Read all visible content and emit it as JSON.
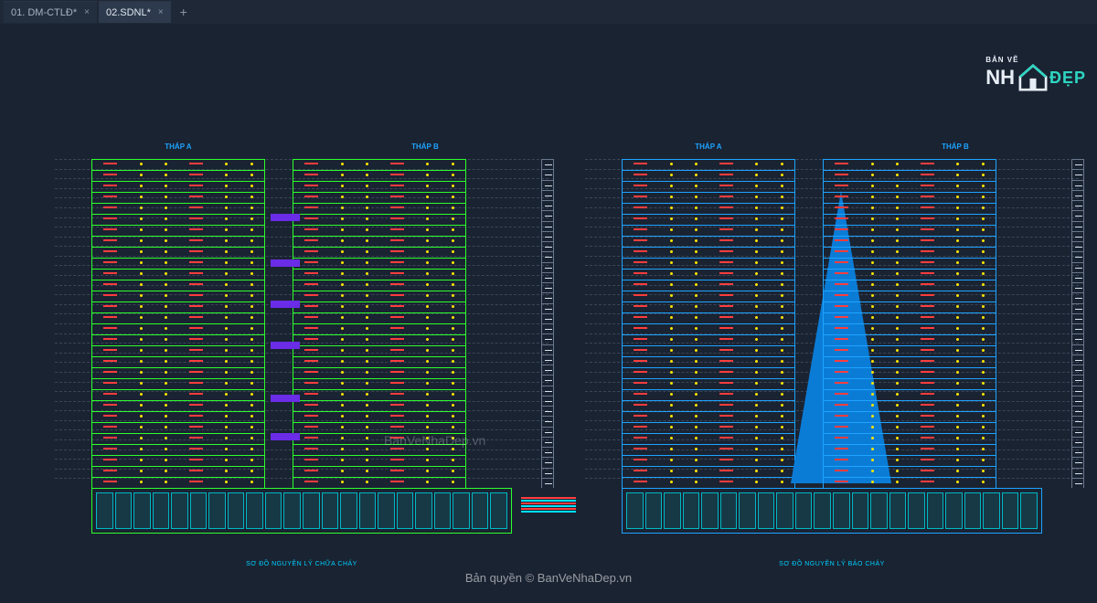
{
  "tabs": [
    {
      "label": "01. DM-CTLĐ*",
      "active": false
    },
    {
      "label": "02.SDNL*",
      "active": true
    }
  ],
  "drawings": {
    "left": {
      "titles": {
        "a": "THÁP A",
        "b": "THÁP B"
      },
      "caption": "SƠ ĐỒ NGUYÊN LÝ CHỮA CHÁY"
    },
    "right": {
      "titles": {
        "a": "THÁP A",
        "b": "THÁP B"
      },
      "caption": "SƠ ĐỒ NGUYÊN LÝ BÁO CHÁY"
    }
  },
  "watermark": {
    "center": "BanVeNhaDep.vn",
    "bottom": "Bản quyền © BanVeNhaDep.vn"
  },
  "logo": {
    "top": "BẢN VẼ",
    "prefix": "NH",
    "suffix": "ĐẸP"
  },
  "icons": {
    "close": "×",
    "add": "+"
  }
}
